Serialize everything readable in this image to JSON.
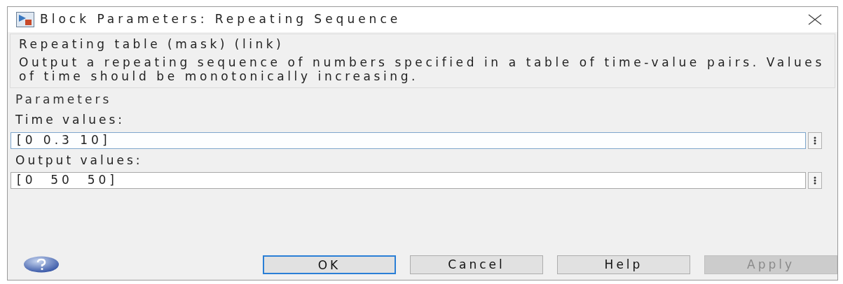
{
  "window": {
    "title": "Block Parameters: Repeating Sequence"
  },
  "description": {
    "heading": "Repeating table (mask) (link)",
    "text": "Output a repeating sequence of numbers specified in a table of time-value pairs. Values of time should be monotonically increasing."
  },
  "parameters": {
    "heading": "Parameters",
    "fields": [
      {
        "label": "Time values:",
        "value": "[0 0.3 10]",
        "focused": true
      },
      {
        "label": "Output values:",
        "value": "[0  50  50]",
        "focused": false
      }
    ]
  },
  "buttons": [
    {
      "label": "OK",
      "default": true,
      "disabled": false
    },
    {
      "label": "Cancel",
      "default": false,
      "disabled": false
    },
    {
      "label": "Help",
      "default": false,
      "disabled": false
    },
    {
      "label": "Apply",
      "default": false,
      "disabled": true
    }
  ]
}
